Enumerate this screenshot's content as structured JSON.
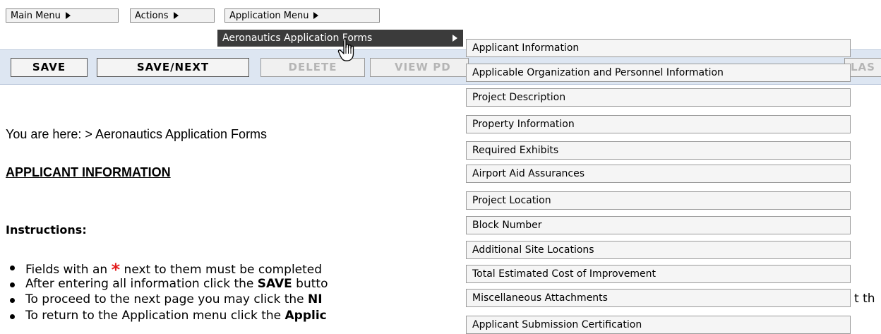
{
  "menubar": {
    "main_menu": "Main Menu",
    "actions": "Actions",
    "application_menu": "Application Menu"
  },
  "submenu": {
    "label": "Aeronautics Application Forms"
  },
  "toolbar": {
    "save": "SAVE",
    "save_next": "SAVE/NEXT",
    "delete": "DELETE",
    "view_pdf": "VIEW PD",
    "clipped_right": "LAS"
  },
  "flyout": {
    "items": [
      "Applicant Information",
      "Applicable Organization and Personnel Information",
      "Project Description",
      "Property Information",
      "Required Exhibits",
      "Airport Aid Assurances",
      "Project Location",
      "Block Number",
      "Additional Site Locations",
      "Total Estimated Cost of Improvement",
      "Miscellaneous Attachments",
      "Applicant Submission Certification"
    ]
  },
  "page": {
    "breadcrumb": "You are here: > Aeronautics Application Forms",
    "title": "APPLICANT INFORMATION",
    "instructions_title": "Instructions:",
    "instr1_a": "Fields with an ",
    "instr1_star": "*",
    "instr1_b": " next to them must be completed",
    "instr2_a": "After entering all information click the ",
    "instr2_bold": "SAVE",
    "instr2_b": " butto",
    "instr3_a": "To proceed to the next page you may click the ",
    "instr3_bold": "NI",
    "instr3_tail": "t th",
    "instr4_a": "To return to the Application menu click the ",
    "instr4_bold": "Applic"
  },
  "icons": {
    "cursor": "hand-pointer-icon",
    "arrow": "triangle-right-icon"
  }
}
